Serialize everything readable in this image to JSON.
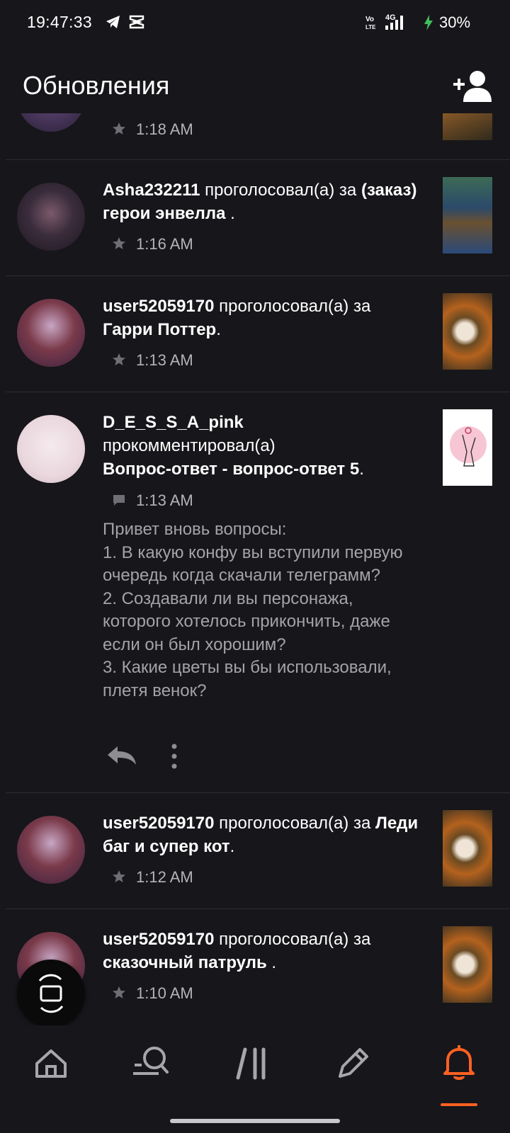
{
  "status_bar": {
    "time": "19:47:33",
    "battery": "30%",
    "icons": [
      "telegram-icon",
      "capcut-icon",
      "volte-icon",
      "signal-4g-icon",
      "charging-icon"
    ]
  },
  "header": {
    "title": "Обновления",
    "add_user_icon": "add-user-icon"
  },
  "feed": {
    "partial_top": {
      "time": "1:18 AM",
      "meta_icon": "star-icon"
    },
    "items": [
      {
        "user": "Asha232211",
        "action": " проголосовал(а) за ",
        "story": "(заказ) герои энвелла",
        "suffix": " .",
        "time": "1:16 AM",
        "meta_icon": "star-icon"
      },
      {
        "user": "user52059170",
        "action": " проголосовал(а) за ",
        "story": "Гарри Поттер",
        "suffix": ".",
        "time": "1:13 AM",
        "meta_icon": "star-icon"
      },
      {
        "user": "D_E_S_S_A_pink",
        "action": "прокомментировал(а)",
        "story": "Вопрос-ответ - вопрос-ответ 5",
        "suffix": ".",
        "time": "1:13 AM",
        "meta_icon": "comment-icon",
        "comment": "Привет вновь вопросы:\n1. В какую конфу вы вступили первую очередь когда скачали телеграмм?\n2. Создавали ли вы персонажа, которого хотелось прикончить, даже если он был хорошим?\n3. Какие цветы вы бы использовали, плетя венок?"
      },
      {
        "user": "user52059170",
        "action": " проголосовал(а) за ",
        "story": "Леди баг и супер кот",
        "suffix": ".",
        "time": "1:12 AM",
        "meta_icon": "star-icon"
      },
      {
        "user": "user52059170",
        "action": " проголосовал(а) за ",
        "story": "сказочный патруль",
        "suffix": " .",
        "time": "1:10 AM",
        "meta_icon": "star-icon"
      }
    ]
  },
  "bottom_nav": {
    "items": [
      "home-icon",
      "search-icon",
      "library-icon",
      "write-icon",
      "notifications-icon"
    ],
    "active": "notifications-icon",
    "accent_color": "#ff6122"
  }
}
